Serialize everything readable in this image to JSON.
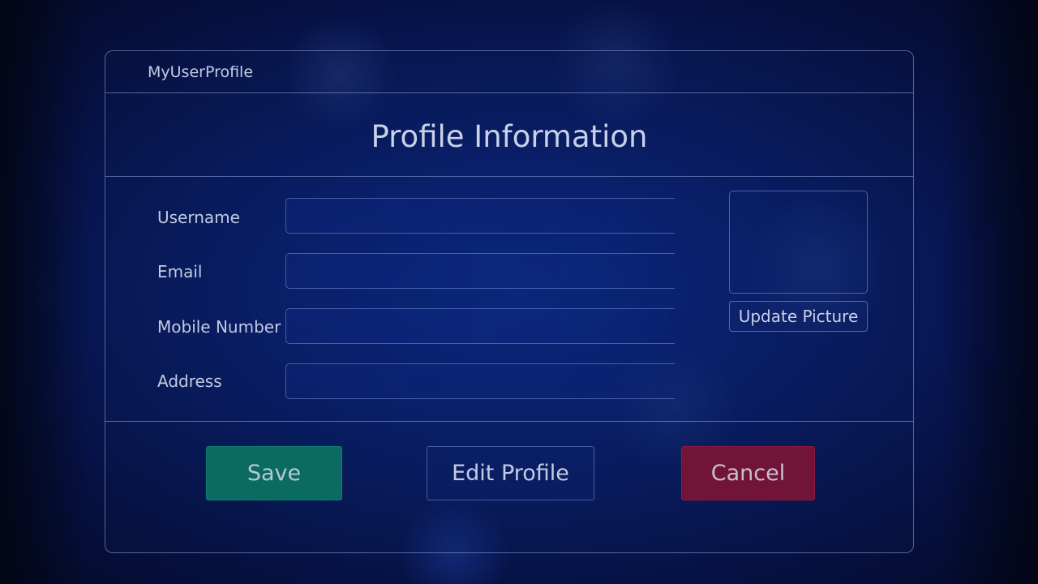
{
  "app": {
    "title": "MyUserProfile"
  },
  "header": {
    "title": "Profile Information"
  },
  "form": {
    "fields": [
      {
        "label": "Username",
        "value": "",
        "placeholder": ""
      },
      {
        "label": "Email",
        "value": "",
        "placeholder": ""
      },
      {
        "label": "Mobile Number",
        "value": "",
        "placeholder": ""
      },
      {
        "label": "Address",
        "value": "",
        "placeholder": ""
      }
    ]
  },
  "picture": {
    "update_label": "Update Picture"
  },
  "actions": {
    "save_label": "Save",
    "edit_label": "Edit Profile",
    "cancel_label": "Cancel"
  },
  "colors": {
    "save": "#0b6a62",
    "cancel": "#721436",
    "background": "#0a2275"
  }
}
